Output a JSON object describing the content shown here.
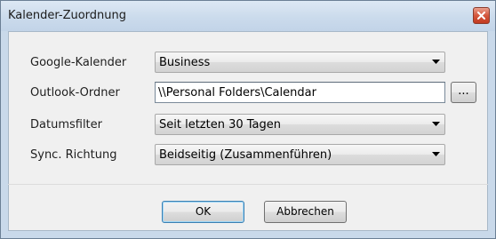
{
  "window": {
    "title": "Kalender-Zuordnung"
  },
  "form": {
    "google_calendar": {
      "label": "Google-Kalender",
      "value": "Business"
    },
    "outlook_folder": {
      "label": "Outlook-Ordner",
      "value": "\\\\Personal Folders\\Calendar",
      "browse_label": "..."
    },
    "date_filter": {
      "label": "Datumsfilter",
      "value": "Seit letzten 30 Tagen"
    },
    "sync_direction": {
      "label": "Sync. Richtung",
      "value": "Beidseitig (Zusammenführen)"
    }
  },
  "buttons": {
    "ok": "OK",
    "cancel": "Abbrechen"
  },
  "icons": {
    "close": "close-icon",
    "dropdown": "chevron-down-icon"
  },
  "colors": {
    "close_button": "#d4573d",
    "titlebar": "#cbdbec",
    "client_bg": "#f0f0f0"
  }
}
